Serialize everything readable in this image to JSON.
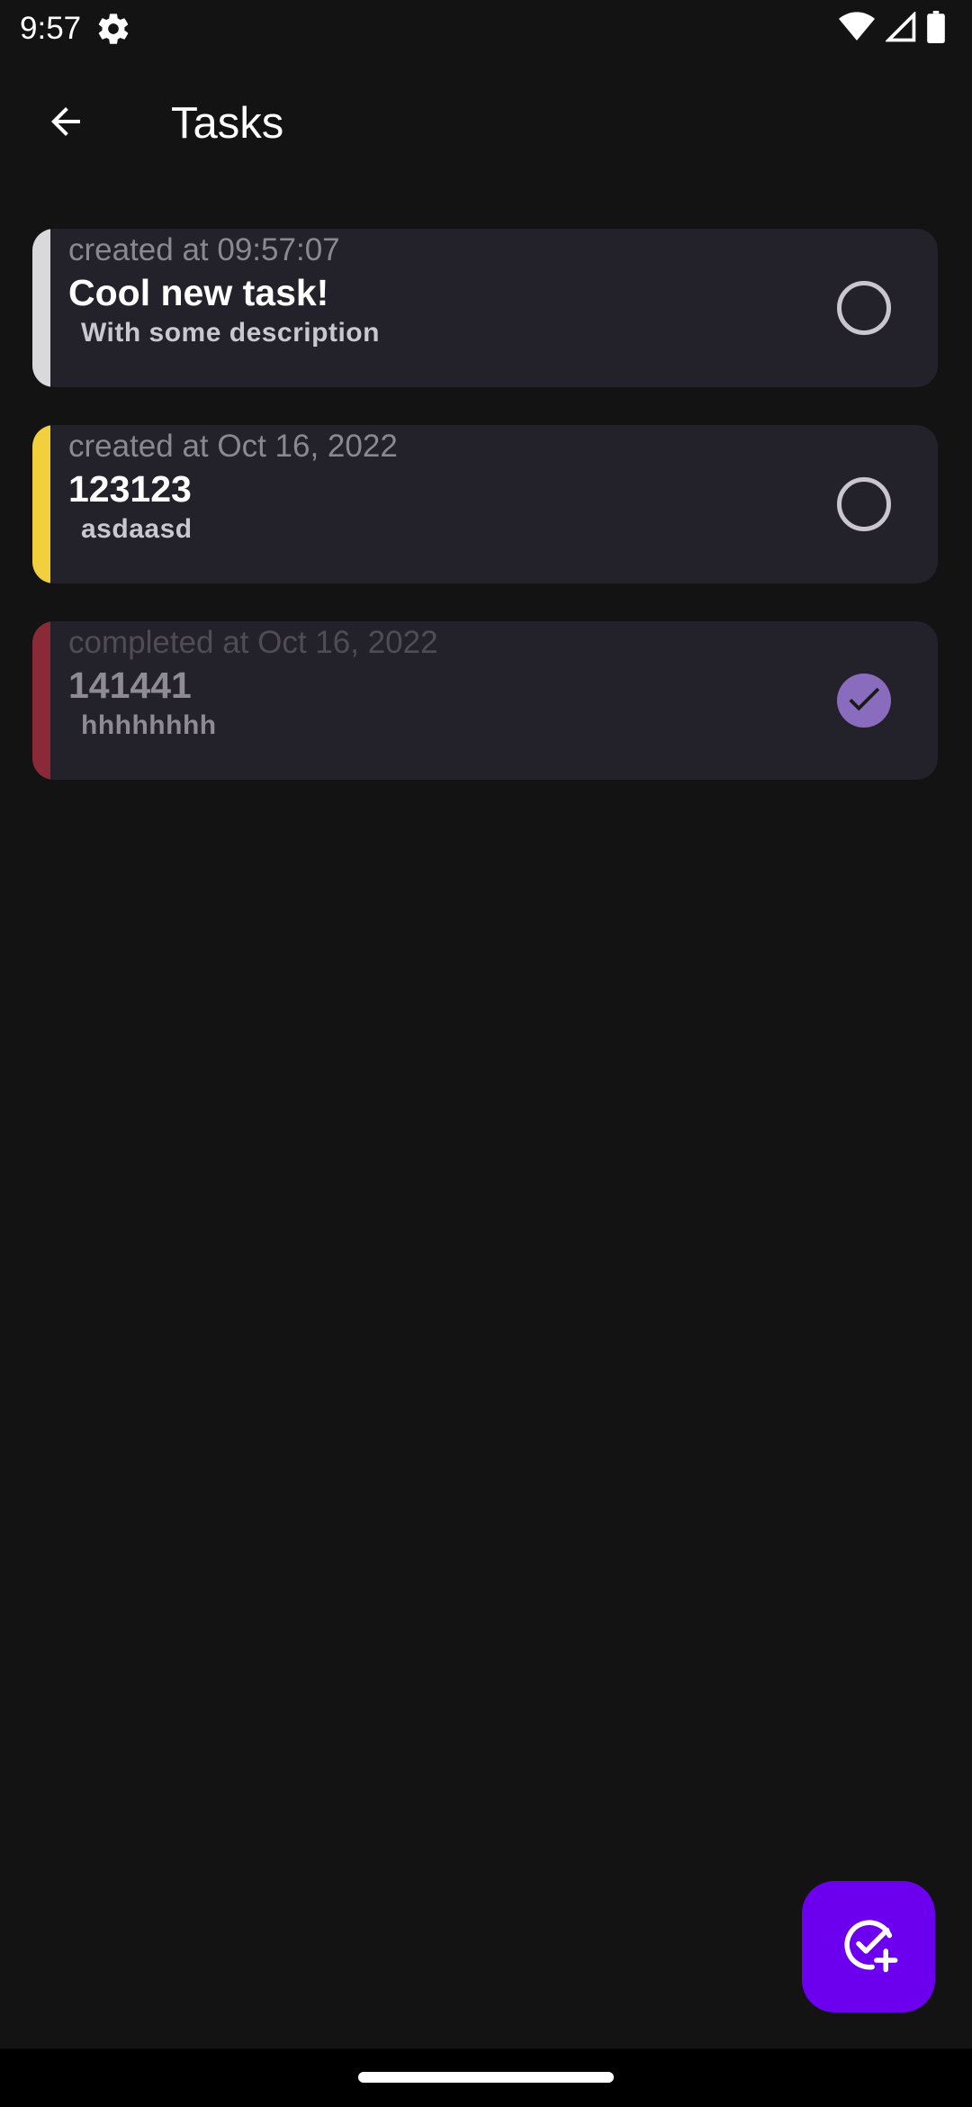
{
  "status_bar": {
    "time": "9:57",
    "icons": [
      "settings-gear-icon",
      "wifi-icon",
      "cellular-signal-icon",
      "battery-icon"
    ]
  },
  "app_bar": {
    "back_icon": "arrow-left-icon",
    "title": "Tasks"
  },
  "tasks": [
    {
      "meta": "created at 09:57:07",
      "title": "Cool new task!",
      "description": "With some description",
      "completed": false,
      "stripe_color": "#d9d9dc"
    },
    {
      "meta": "created at Oct 16, 2022",
      "title": "123123",
      "description": "asdaasd",
      "completed": false,
      "stripe_color": "#f2cf3d"
    },
    {
      "meta": "completed at Oct 16, 2022",
      "title": "141441",
      "description": "hhhhhhhh",
      "completed": true,
      "stripe_color": "#8a2a36"
    }
  ],
  "fab": {
    "icon": "add-task-icon",
    "color": "#6c00ee"
  },
  "colors": {
    "background": "#131314",
    "card": "#232129",
    "accent": "#8a6cbf"
  }
}
